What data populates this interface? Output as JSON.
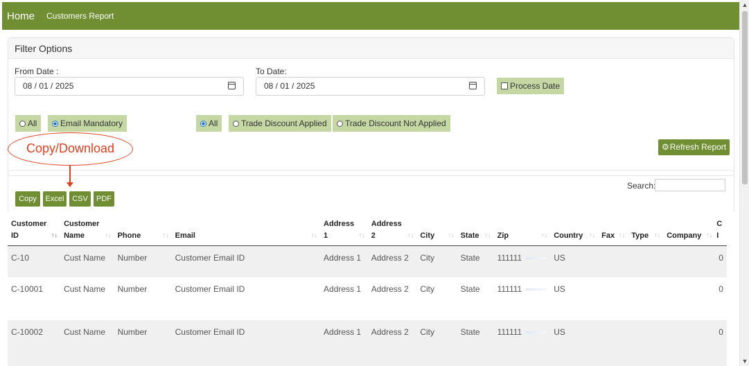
{
  "topbar": {
    "brand": "Home",
    "breadcrumb": "Customers Report"
  },
  "filter": {
    "title": "Filter Options",
    "from_label": "From Date :",
    "from_value": "08 / 01 / 2025",
    "to_label": "To Date:",
    "to_value": "08 / 01 / 2025",
    "process_date_label": "Process Date",
    "email_all_label": "All",
    "email_mandatory_label": "Email Mandatory",
    "trade_all_label": "All",
    "trade_applied_label": "Trade Discount Applied",
    "trade_not_applied_label": "Trade Discount Not Applied",
    "refresh_label": "Refresh Report"
  },
  "annotation": {
    "callout_text": "Copy/Download",
    "color": "#e0401e"
  },
  "toolbar": {
    "copy": "Copy",
    "excel": "Excel",
    "csv": "CSV",
    "pdf": "PDF",
    "search_label": "Search:"
  },
  "table": {
    "headers": {
      "id_1": "Customer",
      "id_2": "ID",
      "name_1": "Customer",
      "name_2": "Name",
      "phone": "Phone",
      "email": "Email",
      "addr1_1": "Address",
      "addr1_2": "1",
      "addr2_1": "Address",
      "addr2_2": "2",
      "city": "City",
      "state": "State",
      "zip": "Zip",
      "country": "Country",
      "fax": "Fax",
      "type": "Type",
      "company": "Company",
      "last_1": "C",
      "last_2": "I"
    },
    "rows": [
      {
        "id": "C-10",
        "name": "Cust Name",
        "phone": "Number",
        "email": "Customer Email ID",
        "addr1": "Address 1",
        "addr2": "Address 2",
        "city": "City",
        "state": "State",
        "zip": "111111",
        "country": "US",
        "last": "0"
      },
      {
        "id": "C-10001",
        "name": "Cust Name",
        "phone": "Number",
        "email": "Customer Email ID",
        "addr1": "Address 1",
        "addr2": "Address 2",
        "city": "City",
        "state": "State",
        "zip": "111111",
        "country": "US",
        "last": "0"
      },
      {
        "id": "C-10002",
        "name": "Cust Name",
        "phone": "Number",
        "email": "Customer Email ID",
        "addr1": "Address 1",
        "addr2": "Address 2",
        "city": "City",
        "state": "State",
        "zip": "111111",
        "country": "US",
        "last": "0"
      }
    ]
  },
  "colors": {
    "accent": "#6f8f32",
    "chip": "#c5d8a4"
  }
}
